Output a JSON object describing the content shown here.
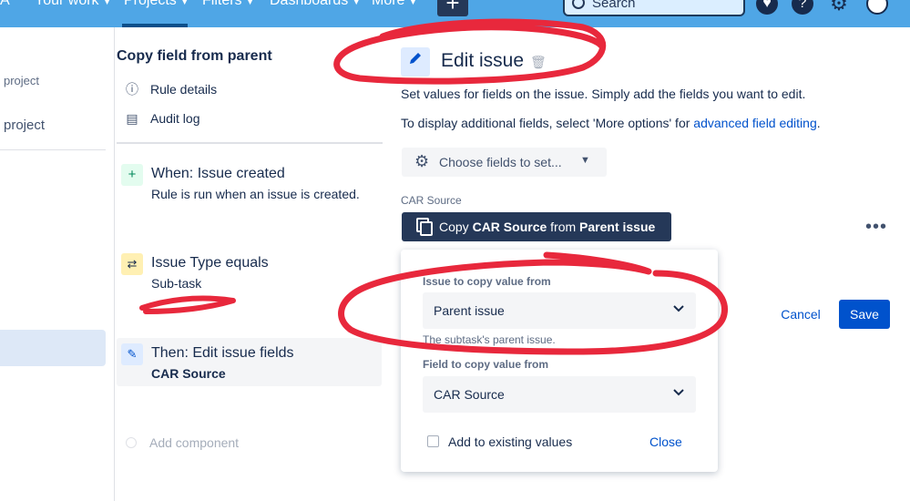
{
  "topnav": {
    "partial_left": "A",
    "your_work": "Your work",
    "projects": "Projects",
    "filters": "Filters",
    "dashboards": "Dashboards",
    "more": "More",
    "create": "+",
    "search_placeholder": "Search",
    "bg_color": "#4fa6e6"
  },
  "left_sidebar": {
    "item1": "project",
    "item2": "project"
  },
  "rule_panel": {
    "title": "Copy field from parent",
    "menu": [
      {
        "icon": "info-icon",
        "label": "Rule details"
      },
      {
        "icon": "document-icon",
        "label": "Audit log"
      }
    ],
    "components": [
      {
        "icon": "plus-icon",
        "title": "When: Issue created",
        "subtitle": "Rule is run when an issue is created."
      },
      {
        "icon": "shuffle-icon",
        "title": "Issue Type equals",
        "subtitle": "Sub-task"
      },
      {
        "icon": "pencil-icon",
        "title": "Then: Edit issue fields",
        "subtitle": "CAR Source"
      }
    ],
    "add_component": "Add component"
  },
  "edit_panel": {
    "title": "Edit issue",
    "description": "Set values for fields on the issue. Simply add the fields you want to edit.",
    "more_options_prefix": "To display additional fields, select 'More options' for ",
    "more_options_link": "advanced field editing",
    "more_options_suffix": ".",
    "choose_fields": "Choose fields to set...",
    "field_label": "CAR Source",
    "copy_button": {
      "prefix": "Copy ",
      "field": "CAR Source",
      "middle": " from ",
      "source": "Parent issue"
    },
    "cancel": "Cancel",
    "save": "Save",
    "accent_color": "#0052cc"
  },
  "popup": {
    "issue_label": "Issue to copy value from",
    "issue_value": "Parent issue",
    "helper": "The subtask's parent issue.",
    "field_label": "Field to copy value from",
    "field_value": "CAR Source",
    "checkbox_label": "Add to existing values",
    "checkbox_checked": false,
    "close": "Close"
  },
  "annotation_color": "#e8283c"
}
